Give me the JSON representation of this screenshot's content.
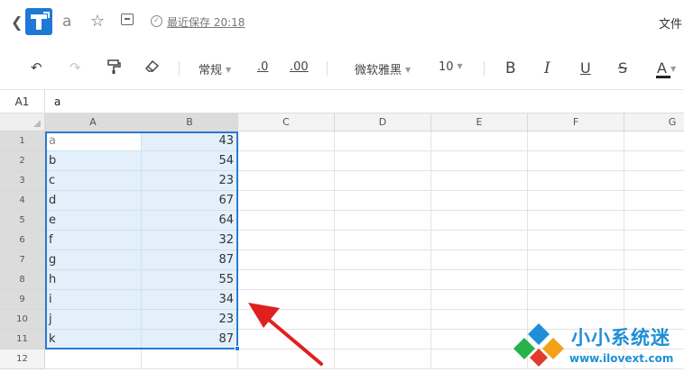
{
  "titlebar": {
    "doc_name": "a",
    "save_status": "最近保存 20:18",
    "file_menu": "文件"
  },
  "toolbar": {
    "number_format": "常规",
    "decimal_decrease": ".0",
    "decimal_increase": ".00",
    "font_family": "微软雅黑",
    "font_size": "10",
    "bold": "B",
    "italic": "I",
    "underline": "U",
    "strikethrough": "S",
    "font_color": "A"
  },
  "formula_bar": {
    "cell_ref": "A1",
    "value": "a"
  },
  "sheet": {
    "columns": [
      "A",
      "B",
      "C",
      "D",
      "E",
      "F",
      "G"
    ],
    "rows": [
      "1",
      "2",
      "3",
      "4",
      "5",
      "6",
      "7",
      "8",
      "9",
      "10",
      "11",
      "12"
    ],
    "data": [
      [
        "a",
        "43"
      ],
      [
        "b",
        "54"
      ],
      [
        "c",
        "23"
      ],
      [
        "d",
        "67"
      ],
      [
        "e",
        "64"
      ],
      [
        "f",
        "32"
      ],
      [
        "g",
        "87"
      ],
      [
        "h",
        "55"
      ],
      [
        "i",
        "34"
      ],
      [
        "j",
        "23"
      ],
      [
        "k",
        "87"
      ]
    ]
  },
  "colors": {
    "selection_border": "#2a7ad0",
    "selection_fill": "#e3f0fb",
    "annotation_arrow": "#e02020",
    "watermark": "#1e8fd6"
  },
  "watermark": {
    "title": "小小系统迷",
    "url": "www.ilovext.com"
  }
}
